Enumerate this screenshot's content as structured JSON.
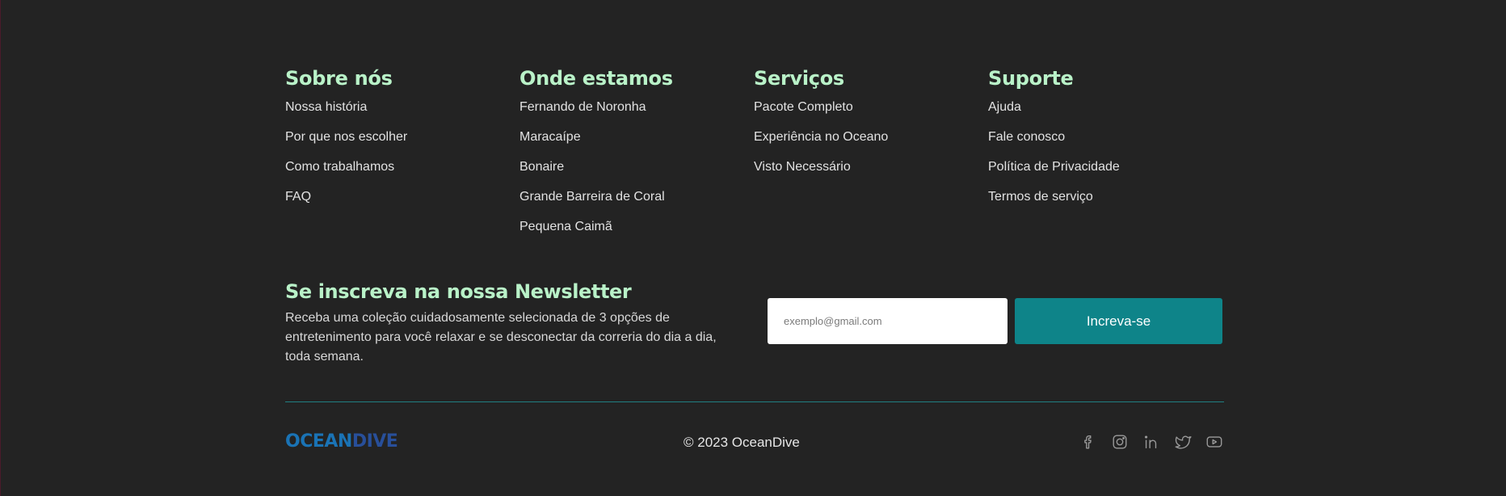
{
  "columns": [
    {
      "title": "Sobre nós",
      "links": [
        "Nossa história",
        "Por que nos escolher",
        "Como trabalhamos",
        "FAQ"
      ]
    },
    {
      "title": "Onde estamos",
      "links": [
        "Fernando de Noronha",
        "Maracaípe",
        "Bonaire",
        "Grande Barreira de Coral",
        "Pequena Caimã"
      ]
    },
    {
      "title": "Serviços",
      "links": [
        "Pacote Completo",
        "Experiência no Oceano",
        "Visto Necessário"
      ]
    },
    {
      "title": "Suporte",
      "links": [
        "Ajuda",
        "Fale conosco",
        "Política de Privacidade",
        "Termos de serviço"
      ]
    }
  ],
  "newsletter": {
    "title": "Se inscreva na nossa Newsletter",
    "description": "Receba uma coleção cuidadosamente selecionada de 3 opções de entretenimento para você relaxar e se desconectar da correria do dia a dia, toda semana.",
    "email_placeholder": "exemplo@gmail.com",
    "email_value": "",
    "button_label": "Increva-se"
  },
  "footer": {
    "logo_part1": "OCEAN",
    "logo_part2": "DIVE",
    "copyright": "© 2023 OceanDive",
    "social_icons": [
      "facebook-icon",
      "instagram-icon",
      "linkedin-icon",
      "twitter-icon",
      "youtube-icon"
    ]
  },
  "colors": {
    "background": "#232323",
    "heading": "#b9f2c8",
    "accent": "#0e8489",
    "logo_ocean": "#1a73b5",
    "logo_dive": "#284f9a"
  }
}
